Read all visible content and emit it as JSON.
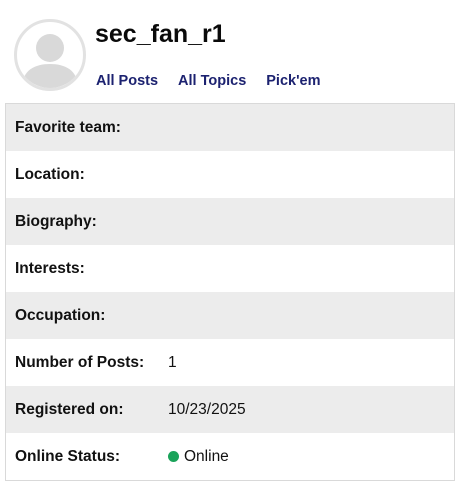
{
  "profile": {
    "username": "sec_fan_r1",
    "avatar_icon": "default-user-avatar-icon"
  },
  "nav": {
    "all_posts": "All Posts",
    "all_topics": "All Topics",
    "pickem": "Pick'em"
  },
  "details": {
    "favorite_team": {
      "label": "Favorite team:",
      "value": ""
    },
    "location": {
      "label": "Location:",
      "value": ""
    },
    "biography": {
      "label": "Biography:",
      "value": ""
    },
    "interests": {
      "label": "Interests:",
      "value": ""
    },
    "occupation": {
      "label": "Occupation:",
      "value": ""
    },
    "number_of_posts": {
      "label": "Number of Posts:",
      "value": "1"
    },
    "registered_on": {
      "label": "Registered on:",
      "value": "10/23/2025"
    },
    "online_status": {
      "label": "Online Status:",
      "value": "Online",
      "status_color": "#1aa35a"
    }
  },
  "colors": {
    "nav_link": "#1c2270",
    "row_shade": "#ececec",
    "online": "#1aa35a"
  }
}
